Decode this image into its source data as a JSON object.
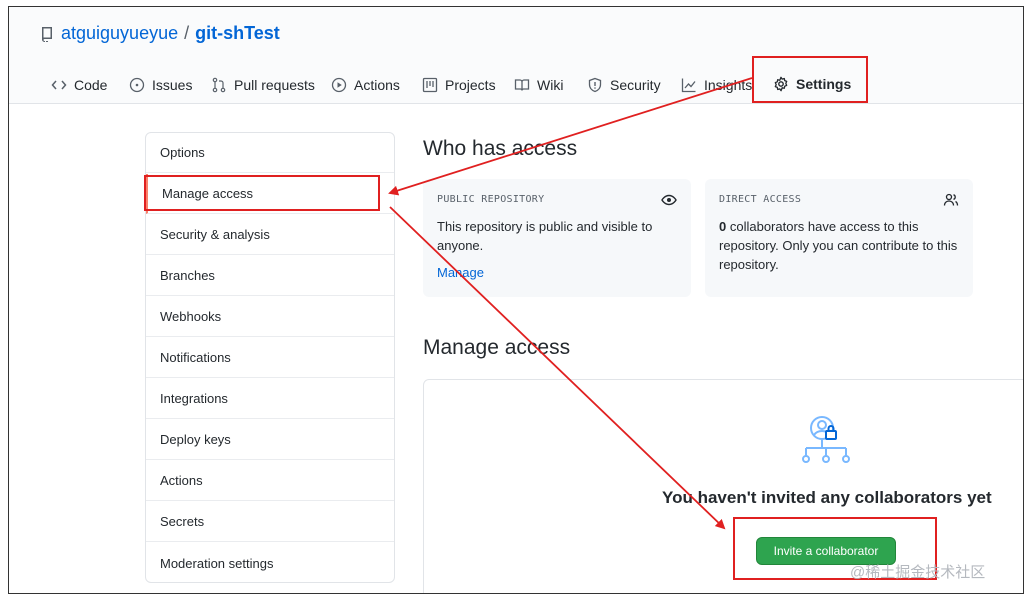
{
  "repo": {
    "owner": "atguiguyueyue",
    "separator": "/",
    "name": "git-shTest"
  },
  "tabs": [
    {
      "label": "Code",
      "icon": "code-icon"
    },
    {
      "label": "Issues",
      "icon": "issue-icon"
    },
    {
      "label": "Pull requests",
      "icon": "pull-request-icon"
    },
    {
      "label": "Actions",
      "icon": "play-icon"
    },
    {
      "label": "Projects",
      "icon": "project-icon"
    },
    {
      "label": "Wiki",
      "icon": "book-icon"
    },
    {
      "label": "Security",
      "icon": "shield-icon"
    },
    {
      "label": "Insights",
      "icon": "graph-icon"
    },
    {
      "label": "Settings",
      "icon": "gear-icon"
    }
  ],
  "sidebar": {
    "items": [
      {
        "label": "Options"
      },
      {
        "label": "Manage access"
      },
      {
        "label": "Security & analysis"
      },
      {
        "label": "Branches"
      },
      {
        "label": "Webhooks"
      },
      {
        "label": "Notifications"
      },
      {
        "label": "Integrations"
      },
      {
        "label": "Deploy keys"
      },
      {
        "label": "Actions"
      },
      {
        "label": "Secrets"
      },
      {
        "label": "Moderation settings"
      }
    ]
  },
  "who_has_access": {
    "title": "Who has access",
    "public_label": "PUBLIC REPOSITORY",
    "public_text_1": "This repository is public and visible to",
    "public_text_2": "anyone.",
    "manage_link": "Manage",
    "direct_label": "DIRECT ACCESS",
    "direct_count": "0",
    "direct_text_1": " collaborators have access to this",
    "direct_text_2": "repository. Only you can contribute to this",
    "direct_text_3": "repository."
  },
  "manage_access": {
    "title": "Manage access",
    "empty_text": "You haven't invited any collaborators yet",
    "invite_button": "Invite a collaborator"
  },
  "watermark": "@稀土掘金技术社区",
  "colors": {
    "link": "#0366d6",
    "button": "#2ea44f",
    "annotation": "#e02020",
    "tab_underline": "#f9826c"
  }
}
